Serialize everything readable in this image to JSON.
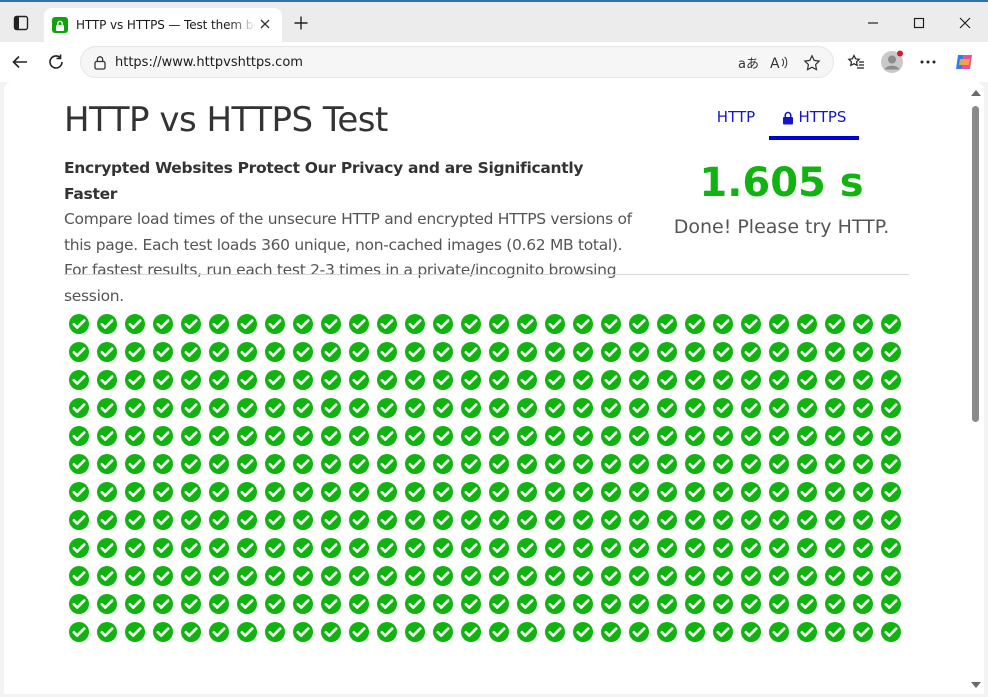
{
  "browser": {
    "tab_title": "HTTP vs HTTPS — Test them both",
    "url": "https://www.httpvshttps.com"
  },
  "page": {
    "title": "HTTP vs HTTPS Test",
    "lead": "Encrypted Websites Protect Our Privacy and are Significantly Faster",
    "description": "Compare load times of the unsecure HTTP and encrypted HTTPS versions of this page. Each test loads 360 unique, non-cached images (0.62 MB total). For fastest results, run each test 2-3 times in a private/incognito browsing session.",
    "tabs": [
      {
        "label": "HTTP",
        "active": false
      },
      {
        "label": "HTTPS",
        "active": true,
        "icon": "lock-icon"
      }
    ],
    "result_time": "1.605 s",
    "result_message": "Done! Please try HTTP."
  },
  "grid": {
    "columns": 30,
    "visible_rows": 12,
    "icon": "check-circle-icon",
    "color": "#10b310"
  },
  "colors": {
    "accent_blue": "#0000d6",
    "success_green": "#10b310"
  }
}
